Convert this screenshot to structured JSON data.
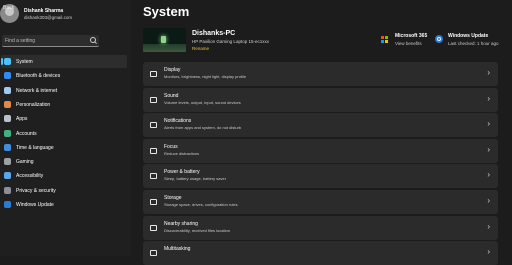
{
  "window": {
    "back_label": "Back"
  },
  "user": {
    "name": "Dishank Sharma",
    "email": "dishank303@gmail.com"
  },
  "search": {
    "placeholder": "Find a setting"
  },
  "sidebar": {
    "items": [
      {
        "label": "System",
        "icon": "monitor-icon",
        "color": "#4cc2ff",
        "active": true
      },
      {
        "label": "Bluetooth & devices",
        "icon": "bluetooth-icon",
        "color": "#2f8cf0"
      },
      {
        "label": "Network & internet",
        "icon": "wifi-icon",
        "color": "#9ec9f5"
      },
      {
        "label": "Personalization",
        "icon": "brush-icon",
        "color": "#e0894a"
      },
      {
        "label": "Apps",
        "icon": "apps-icon",
        "color": "#b9c2cc"
      },
      {
        "label": "Accounts",
        "icon": "person-icon",
        "color": "#3fb37f"
      },
      {
        "label": "Time & language",
        "icon": "globe-clock-icon",
        "color": "#3b8ee0"
      },
      {
        "label": "Gaming",
        "icon": "controller-icon",
        "color": "#a0a0a0"
      },
      {
        "label": "Accessibility",
        "icon": "accessibility-icon",
        "color": "#5aa6e8"
      },
      {
        "label": "Privacy & security",
        "icon": "shield-icon",
        "color": "#8a8f99"
      },
      {
        "label": "Windows Update",
        "icon": "update-icon",
        "color": "#2a7bd4"
      }
    ]
  },
  "main": {
    "title": "System",
    "device": {
      "name": "Dishanks-PC",
      "model": "HP Pavilion Gaming Laptop 15-ec1xxx",
      "rename": "Rename"
    },
    "m365": {
      "title": "Microsoft 365",
      "sub": "View benefits"
    },
    "update": {
      "title": "Windows Update",
      "sub": "Last checked: 1 hour ago"
    },
    "cards": [
      {
        "title": "Display",
        "desc": "Monitors, brightness, night light, display profile",
        "icon": "display-icon"
      },
      {
        "title": "Sound",
        "desc": "Volume levels, output, input, sound devices",
        "icon": "speaker-icon"
      },
      {
        "title": "Notifications",
        "desc": "Alerts from apps and system, do not disturb",
        "icon": "bell-icon"
      },
      {
        "title": "Focus",
        "desc": "Reduce distractions",
        "icon": "focus-icon"
      },
      {
        "title": "Power & battery",
        "desc": "Sleep, battery usage, battery saver",
        "icon": "power-icon"
      },
      {
        "title": "Storage",
        "desc": "Storage space, drives, configuration rules",
        "icon": "storage-icon"
      },
      {
        "title": "Nearby sharing",
        "desc": "Discoverability, received files location",
        "icon": "share-icon"
      },
      {
        "title": "Multitasking",
        "desc": "",
        "icon": "multitask-icon"
      }
    ]
  }
}
